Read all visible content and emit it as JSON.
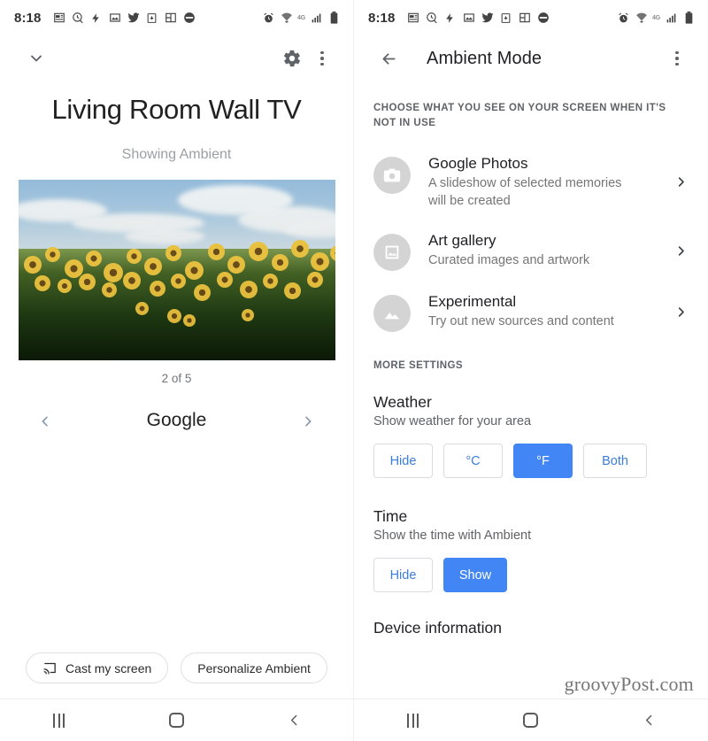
{
  "status_bar": {
    "time": "8:18",
    "left_icons": [
      "news-icon",
      "clock-off-icon",
      "bolt-icon",
      "photo-icon",
      "twitter-icon",
      "save-icon",
      "book-icon",
      "circle-app-icon"
    ],
    "right_icons": [
      "alarm-icon",
      "wifi-calling-icon",
      "mobile-data-label",
      "signal-bars-icon",
      "battery-icon"
    ],
    "network_label": "4G"
  },
  "left_panel": {
    "collapse_icon": "chevron-down-icon",
    "settings_icon": "gear-icon",
    "overflow_icon": "more-vertical-icon",
    "device_title": "Living Room Wall TV",
    "device_status": "Showing Ambient",
    "photo_alt": "sunflower-field-photo",
    "counter": "2 of 5",
    "source_name": "Google",
    "prev_icon": "chevron-left-icon",
    "next_icon": "chevron-right-icon",
    "cast_button": "Cast my screen",
    "cast_icon": "cast-icon",
    "personalize_button": "Personalize Ambient"
  },
  "right_panel": {
    "back_icon": "arrow-left-icon",
    "title": "Ambient Mode",
    "overflow_icon": "more-vertical-icon",
    "section_header": "CHOOSE WHAT YOU SEE ON YOUR SCREEN WHEN IT'S NOT IN USE",
    "sources": [
      {
        "title": "Google Photos",
        "subtitle": "A slideshow of selected memories will be created",
        "icon": "camera-icon"
      },
      {
        "title": "Art gallery",
        "subtitle": "Curated images and artwork",
        "icon": "picture-frame-icon"
      },
      {
        "title": "Experimental",
        "subtitle": "Try out new sources and content",
        "icon": "landscape-icon"
      }
    ],
    "more_settings_header": "MORE SETTINGS",
    "weather": {
      "title": "Weather",
      "subtitle": "Show weather for your area",
      "options": [
        "Hide",
        "°C",
        "°F",
        "Both"
      ],
      "selected": "°F"
    },
    "time": {
      "title": "Time",
      "subtitle": "Show the time with Ambient",
      "options": [
        "Hide",
        "Show"
      ],
      "selected": "Show"
    },
    "device_information": "Device information"
  },
  "nav_bar": {
    "recents_label": "recents-button",
    "home_label": "home-button",
    "back_label": "back-button"
  },
  "watermark": "groovyPost.com",
  "colors": {
    "accent_blue": "#4285F4",
    "link_blue": "#3b7ddd",
    "text_primary": "#202124",
    "text_secondary": "#5f6368",
    "icon_circle_gray": "#d4d4d4"
  }
}
